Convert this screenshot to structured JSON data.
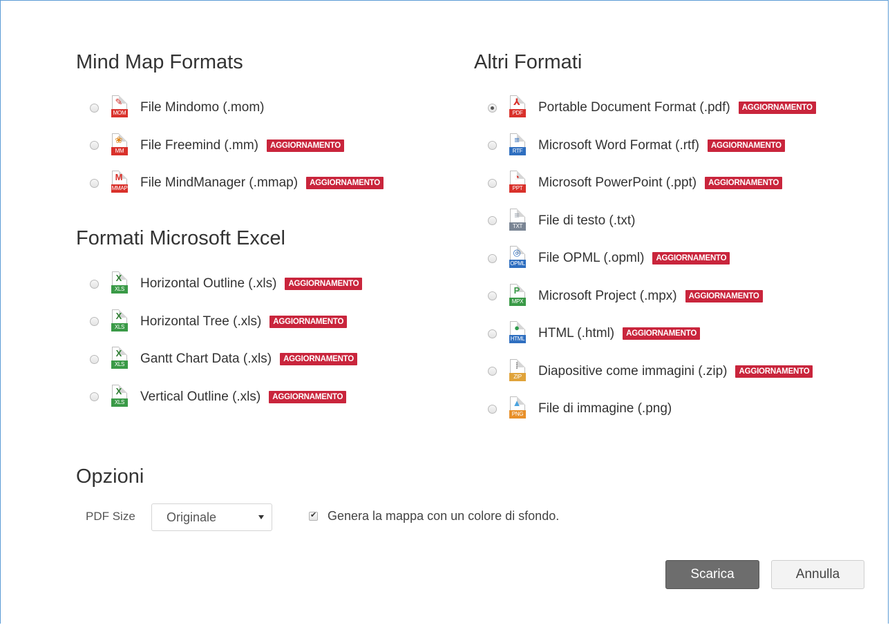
{
  "sections": {
    "mind_map": {
      "title": "Mind Map Formats",
      "items": [
        {
          "label": "File Mindomo (.mom)",
          "icon": "mom-file-icon",
          "tag": "MOM",
          "tag_color": "#d9312b",
          "glyph": "✎",
          "glyph_color": "#d9312b",
          "badge": "",
          "checked": false
        },
        {
          "label": "File Freemind (.mm)",
          "icon": "freemind-file-icon",
          "tag": "MM",
          "tag_color": "#d9312b",
          "glyph": "❀",
          "glyph_color": "#e08a1e",
          "badge": "AGGIORNAMENTO",
          "checked": false
        },
        {
          "label": "File MindManager (.mmap)",
          "icon": "mindmanager-file-icon",
          "tag": "MMAP",
          "tag_color": "#d9312b",
          "glyph": "M",
          "glyph_color": "#d9312b",
          "badge": "AGGIORNAMENTO",
          "checked": false
        }
      ]
    },
    "excel": {
      "title": "Formati Microsoft Excel",
      "items": [
        {
          "label": "Horizontal Outline (.xls)",
          "icon": "xls-file-icon",
          "tag": "XLS",
          "tag_color": "#3a9a47",
          "glyph": "X",
          "glyph_color": "#2e7d32",
          "badge": "AGGIORNAMENTO",
          "checked": false
        },
        {
          "label": "Horizontal Tree (.xls)",
          "icon": "xls-file-icon",
          "tag": "XLS",
          "tag_color": "#3a9a47",
          "glyph": "X",
          "glyph_color": "#2e7d32",
          "badge": "AGGIORNAMENTO",
          "checked": false
        },
        {
          "label": "Gantt Chart Data (.xls)",
          "icon": "xls-file-icon",
          "tag": "XLS",
          "tag_color": "#3a9a47",
          "glyph": "X",
          "glyph_color": "#2e7d32",
          "badge": "AGGIORNAMENTO",
          "checked": false
        },
        {
          "label": "Vertical Outline (.xls)",
          "icon": "xls-file-icon",
          "tag": "XLS",
          "tag_color": "#3a9a47",
          "glyph": "X",
          "glyph_color": "#2e7d32",
          "badge": "AGGIORNAMENTO",
          "checked": false
        }
      ]
    },
    "altri": {
      "title": "Altri Formati",
      "items": [
        {
          "label": "Portable Document Format (.pdf)",
          "icon": "pdf-file-icon",
          "tag": "PDF",
          "tag_color": "#d9312b",
          "glyph": "⅄",
          "glyph_color": "#d9312b",
          "badge": "AGGIORNAMENTO",
          "checked": true
        },
        {
          "label": "Microsoft Word Format (.rtf)",
          "icon": "rtf-file-icon",
          "tag": "RTF",
          "tag_color": "#2f6fc0",
          "glyph": "≡",
          "glyph_color": "#2f6fc0",
          "badge": "AGGIORNAMENTO",
          "checked": false
        },
        {
          "label": "Microsoft PowerPoint (.ppt)",
          "icon": "ppt-file-icon",
          "tag": "PPT",
          "tag_color": "#d9312b",
          "glyph": "◔",
          "glyph_color": "#d9312b",
          "badge": "AGGIORNAMENTO",
          "checked": false
        },
        {
          "label": "File di testo (.txt)",
          "icon": "txt-file-icon",
          "tag": "TXT",
          "tag_color": "#7a8594",
          "glyph": "≡",
          "glyph_color": "#9aa3ad",
          "badge": "",
          "checked": false
        },
        {
          "label": "File OPML (.opml)",
          "icon": "opml-file-icon",
          "tag": "OPML",
          "tag_color": "#2f6fc0",
          "glyph": "◎",
          "glyph_color": "#2f6fc0",
          "badge": "AGGIORNAMENTO",
          "checked": false
        },
        {
          "label": "Microsoft Project (.mpx)",
          "icon": "mpx-file-icon",
          "tag": "MPX",
          "tag_color": "#3a9a47",
          "glyph": "P",
          "glyph_color": "#3a9a47",
          "badge": "AGGIORNAMENTO",
          "checked": false
        },
        {
          "label": "HTML (.html)",
          "icon": "html-file-icon",
          "tag": "HTML",
          "tag_color": "#2f6fc0",
          "glyph": "●",
          "glyph_color": "#2e9c4d",
          "badge": "AGGIORNAMENTO",
          "checked": false
        },
        {
          "label": "Diapositive come immagini (.zip)",
          "icon": "zip-file-icon",
          "tag": "ZIP",
          "tag_color": "#e0a33a",
          "glyph": "⁞",
          "glyph_color": "#8a8a8a",
          "badge": "AGGIORNAMENTO",
          "checked": false
        },
        {
          "label": "File di immagine (.png)",
          "icon": "png-file-icon",
          "tag": "PNG",
          "tag_color": "#e8902a",
          "glyph": "▲",
          "glyph_color": "#4aa3df",
          "badge": "",
          "checked": false
        }
      ]
    }
  },
  "options": {
    "title": "Opzioni",
    "pdf_size_label": "PDF Size",
    "pdf_size_value": "Originale",
    "background_checkbox_label": "Genera la mappa con un colore di sfondo.",
    "background_checked": true
  },
  "buttons": {
    "download": "Scarica",
    "cancel": "Annulla"
  },
  "colors": {
    "badge": "#c9253c",
    "primary_button": "#6d6d6d",
    "frame_border": "#5b9bd5"
  }
}
